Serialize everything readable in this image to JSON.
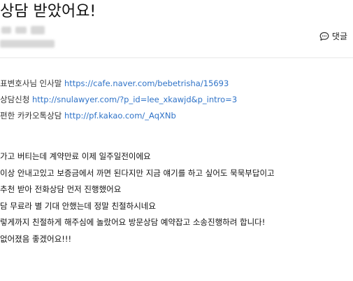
{
  "post": {
    "title": "상담 받았어요!",
    "comment_label": "댓글"
  },
  "links": [
    {
      "label": "표변호사님 인사말 ",
      "url": "https://cafe.naver.com/bebetrisha/15693"
    },
    {
      "label": "상담신청 ",
      "url": "http://snulawyer.com/?p_id=lee_xkawjd&p_intro=3"
    },
    {
      "label": "편한 카카오톡상담 ",
      "url": "http://pf.kakao.com/_AqXNb"
    }
  ],
  "body_lines": [
    "가고 버티는데 계약만료 이제 일주일전이에요",
    "이상 안내고있고 보증금에서 까면 된다지만 지금 얘기를 하고 싶어도 묵묵부답이고",
    "추천 받아 전화상담 먼저 진행했어요",
    "담 무료라 별 기대 안했는데 정말 친절하시네요",
    "렇게까지 친절하게 해주심에 놀랐어요 방문상담 예약잡고 소송진행하려 합니다!",
    "없어졌음 좋겠어요!!!"
  ],
  "icons": {
    "comment": "speech-bubble-icon"
  },
  "colors": {
    "link": "#2f73c8",
    "text": "#111111",
    "divider": "#e8e8e8"
  }
}
